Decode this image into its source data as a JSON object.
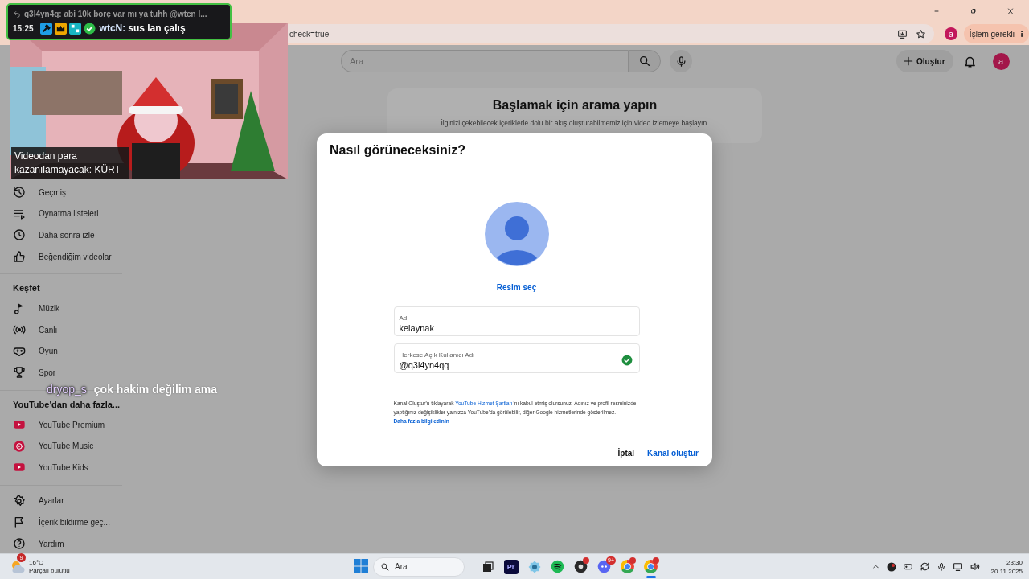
{
  "browser": {
    "address": "check=true",
    "profile_initial": "a",
    "action_button": "İşlem gerekli"
  },
  "chat_overlay": {
    "reply_text": "q3l4yn4q: abi 10k borç var mı ya tuhh @wtcn l...",
    "time": "15:25",
    "author": "wtcN:",
    "message": "sus lan çalış"
  },
  "stream": {
    "kind": "picture",
    "caption": "Videodan para kazanılamayacak: KÜRT"
  },
  "youtube": {
    "search_placeholder": "Ara",
    "create_button": "Oluştur",
    "avatar_initial": "a",
    "sidebar": [
      {
        "items": [
          {
            "label": "Geçmiş"
          },
          {
            "label": "Oynatma listeleri"
          },
          {
            "label": "Daha sonra izle"
          },
          {
            "label": "Beğendiğim videolar"
          }
        ]
      },
      {
        "title": "Keşfet",
        "items": [
          {
            "label": "Müzik"
          },
          {
            "label": "Canlı"
          },
          {
            "label": "Oyun"
          },
          {
            "label": "Spor"
          }
        ]
      },
      {
        "title": "YouTube'dan daha fazla...",
        "items": [
          {
            "label": "YouTube Premium"
          },
          {
            "label": "YouTube Music"
          },
          {
            "label": "YouTube Kids"
          }
        ]
      },
      {
        "items": [
          {
            "label": "Ayarlar"
          },
          {
            "label": "İçerik bildirme geç..."
          },
          {
            "label": "Yardım"
          }
        ]
      }
    ],
    "prompt": {
      "title": "Başlamak için arama yapın",
      "text": "İlginizi çekebilecek içeriklerle dolu bir akış oluşturabilmemiz için video izlemeye başlayın."
    }
  },
  "floating_chat": {
    "author": "dryop_s",
    "message": "çok hakim değilim ama"
  },
  "dialog": {
    "title": "Nasıl görüneceksiniz?",
    "picture_link": "Resim seç",
    "fields": [
      {
        "label": "Ad",
        "value": "kelaynak",
        "valid": false
      },
      {
        "label": "Herkese Açık Kullanıcı Adı",
        "value": "@q3l4yn4qq",
        "valid": true
      }
    ],
    "legal": {
      "before": "Kanal Oluştur'u tıklayarak ",
      "link": "YouTube Hizmet Şartları",
      "after": "'nı kabul etmiş olursunuz. Adınız ve profil resminizde yaptığınız değişiklikler yalnızca YouTube'da görülebilir, diğer Google hizmetlerinde gösterilmez."
    },
    "more_link": "Daha fazla bilgi edinin",
    "buttons": [
      {
        "label": "İptal",
        "kind": "plain"
      },
      {
        "label": "Kanal oluştur",
        "kind": "primary"
      }
    ]
  },
  "taskbar": {
    "weather": {
      "badge": "9",
      "temperature": "16°C",
      "condition": "Parçalı bulutlu"
    },
    "search_placeholder": "Ara",
    "apps": [
      {
        "kind": "taskview",
        "alert": false,
        "active": false
      },
      {
        "kind": "tile",
        "label": "Pr",
        "alert": false,
        "active": false
      },
      {
        "kind": "gear",
        "alert": false,
        "active": false
      },
      {
        "kind": "wave",
        "alert": false,
        "active": false
      },
      {
        "kind": "camera",
        "alert": true,
        "active": false
      },
      {
        "kind": "chat",
        "badge": "9+",
        "alert": false,
        "active": false
      },
      {
        "kind": "browser",
        "alert": true,
        "active": false
      },
      {
        "kind": "browser",
        "alert": true,
        "active": true
      }
    ],
    "time": "23:30",
    "date": "20.11.2025"
  }
}
